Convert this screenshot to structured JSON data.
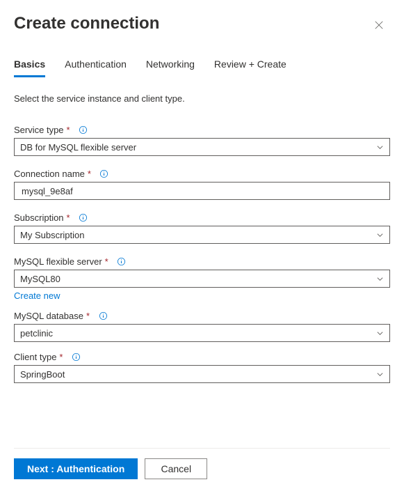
{
  "header": {
    "title": "Create connection"
  },
  "tabs": [
    {
      "label": "Basics",
      "active": true
    },
    {
      "label": "Authentication",
      "active": false
    },
    {
      "label": "Networking",
      "active": false
    },
    {
      "label": "Review + Create",
      "active": false
    }
  ],
  "instruction": "Select the service instance and client type.",
  "fields": {
    "serviceType": {
      "label": "Service type",
      "required": true,
      "value": "DB for MySQL flexible server",
      "kind": "select"
    },
    "connectionName": {
      "label": "Connection name",
      "required": true,
      "value": "mysql_9e8af",
      "kind": "text"
    },
    "subscription": {
      "label": "Subscription",
      "required": true,
      "value": "My Subscription",
      "kind": "select"
    },
    "flexibleServer": {
      "label": "MySQL flexible server",
      "required": true,
      "value": "MySQL80",
      "kind": "select",
      "createNew": "Create new"
    },
    "database": {
      "label": "MySQL database",
      "required": true,
      "value": "petclinic",
      "kind": "select"
    },
    "clientType": {
      "label": "Client type",
      "required": true,
      "value": "SpringBoot",
      "kind": "select"
    }
  },
  "footer": {
    "primary": "Next : Authentication",
    "secondary": "Cancel"
  },
  "glyphs": {
    "required": "*"
  }
}
